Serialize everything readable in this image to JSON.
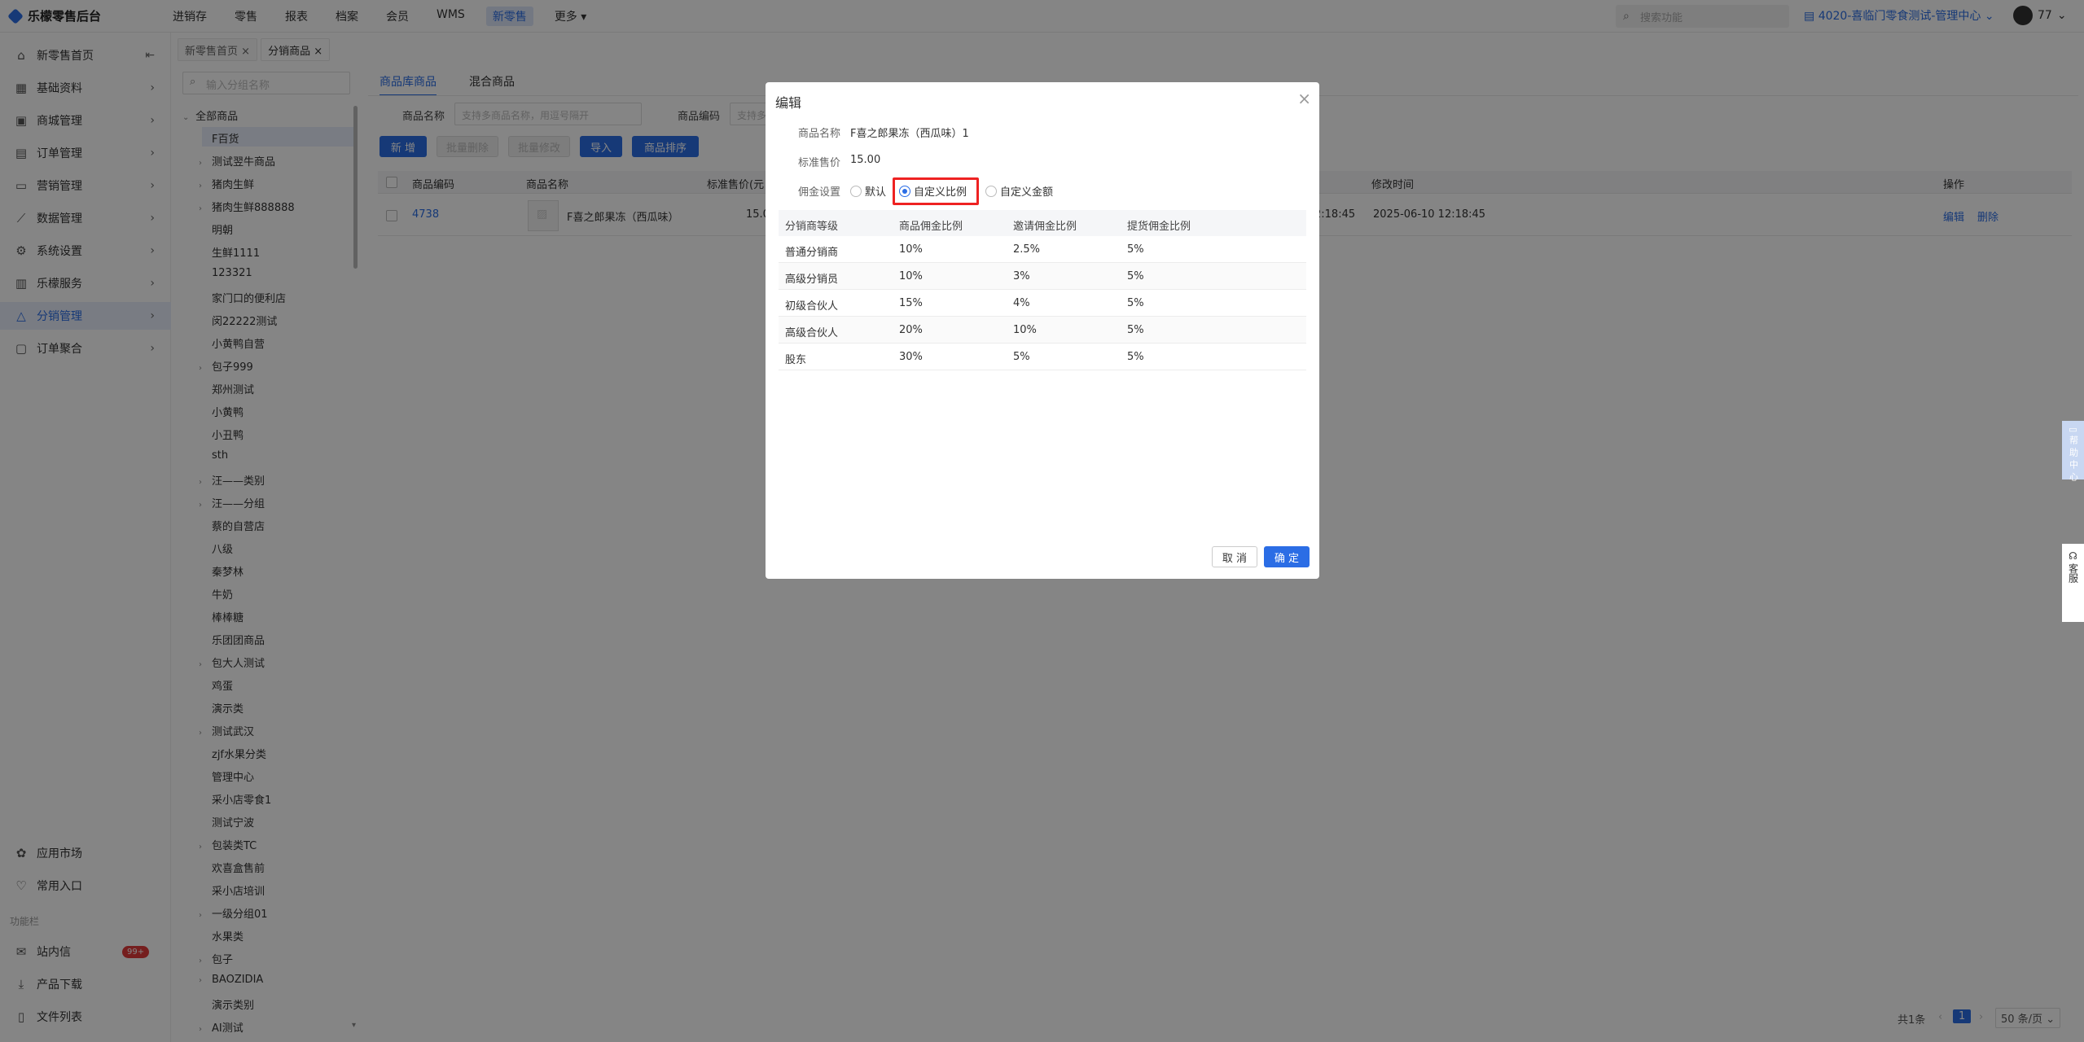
{
  "app": {
    "title": "乐檬零售后台"
  },
  "topnav": [
    "进销存",
    "零售",
    "报表",
    "档案",
    "会员",
    "WMS",
    "新零售",
    "更多"
  ],
  "topnav_active": 6,
  "search": {
    "placeholder": "搜索功能"
  },
  "store": "4020-喜临门零食测试-管理中心",
  "user": {
    "name": "77"
  },
  "sidebar": [
    {
      "label": "新零售首页",
      "icon": "home-icon"
    },
    {
      "label": "基础资料",
      "icon": "grid-icon"
    },
    {
      "label": "商城管理",
      "icon": "store-icon"
    },
    {
      "label": "订单管理",
      "icon": "order-icon"
    },
    {
      "label": "营销管理",
      "icon": "marketing-icon"
    },
    {
      "label": "数据管理",
      "icon": "chart-icon"
    },
    {
      "label": "系统设置",
      "icon": "gear-icon"
    },
    {
      "label": "乐檬服务",
      "icon": "service-icon"
    },
    {
      "label": "分销管理",
      "icon": "distribution-icon"
    },
    {
      "label": "订单聚合",
      "icon": "aggregate-icon"
    }
  ],
  "sidebar_bottom": [
    {
      "label": "应用市场",
      "icon": "apps-icon"
    },
    {
      "label": "常用入口",
      "icon": "heart-icon"
    }
  ],
  "sidebar_section": "功能栏",
  "sidebar_funcs": [
    {
      "label": "站内信",
      "icon": "mail-icon",
      "badge": "99+"
    },
    {
      "label": "产品下载",
      "icon": "download-icon"
    },
    {
      "label": "文件列表",
      "icon": "file-icon"
    }
  ],
  "page_tabs": [
    "新零售首页",
    "分销商品"
  ],
  "tree": {
    "placeholder": "输入分组名称",
    "root": "全部商品",
    "nodes": [
      {
        "label": "F百货",
        "expandable": false
      },
      {
        "label": "测试翌牛商品",
        "expandable": true
      },
      {
        "label": "猪肉生鲜",
        "expandable": true
      },
      {
        "label": "猪肉生鲜888888",
        "expandable": true
      },
      {
        "label": "明朝",
        "expandable": false
      },
      {
        "label": "生鲜1111",
        "expandable": false
      },
      {
        "label": "123321",
        "expandable": false
      },
      {
        "label": "家门口的便利店",
        "expandable": false
      },
      {
        "label": "闵22222测试",
        "expandable": false
      },
      {
        "label": "小黄鸭自营",
        "expandable": false
      },
      {
        "label": "包子999",
        "expandable": true
      },
      {
        "label": "郑州测试",
        "expandable": false
      },
      {
        "label": "小黄鸭",
        "expandable": false
      },
      {
        "label": "小丑鸭",
        "expandable": false
      },
      {
        "label": "sth",
        "expandable": false
      },
      {
        "label": "汪——类别",
        "expandable": true
      },
      {
        "label": "汪——分组",
        "expandable": true
      },
      {
        "label": "蔡的自营店",
        "expandable": false
      },
      {
        "label": "八级",
        "expandable": false
      },
      {
        "label": "秦梦林",
        "expandable": false
      },
      {
        "label": "牛奶",
        "expandable": false
      },
      {
        "label": "棒棒糖",
        "expandable": false
      },
      {
        "label": "乐团团商品",
        "expandable": false
      },
      {
        "label": "包大人测试",
        "expandable": true
      },
      {
        "label": "鸡蛋",
        "expandable": false
      },
      {
        "label": "演示类",
        "expandable": false
      },
      {
        "label": "测试武汉",
        "expandable": true
      },
      {
        "label": "zjf水果分类",
        "expandable": false
      },
      {
        "label": "管理中心",
        "expandable": false
      },
      {
        "label": "采小店零食1",
        "expandable": false
      },
      {
        "label": "测试宁波",
        "expandable": false
      },
      {
        "label": "包装类TC",
        "expandable": true
      },
      {
        "label": "欢喜盒售前",
        "expandable": false
      },
      {
        "label": "采小店培训",
        "expandable": false
      },
      {
        "label": "一级分组01",
        "expandable": true
      },
      {
        "label": "水果类",
        "expandable": false
      },
      {
        "label": "包子",
        "expandable": true
      },
      {
        "label": "BAOZIDIA",
        "expandable": true
      },
      {
        "label": "演示类别",
        "expandable": false
      },
      {
        "label": "AI测试",
        "expandable": true
      }
    ]
  },
  "main": {
    "subtabs": [
      "商品库商品",
      "混合商品"
    ],
    "filter": {
      "name_label": "商品名称",
      "name_placeholder": "支持多商品名称，用逗号隔开",
      "code_label": "商品编码",
      "code_placeholder": "支持多"
    },
    "buttons": {
      "add": "新 增",
      "batch_delete": "批量删除",
      "batch_edit": "批量修改",
      "import": "导入",
      "sort": "商品排序"
    },
    "table": {
      "headers": [
        "商品编码",
        "商品名称",
        "标准售价(元",
        "修改时间",
        "操作"
      ],
      "row": {
        "code": "4738",
        "name": "F喜之郎果冻（西瓜味）",
        "price": "15.0",
        "created_tail": "2:18:45",
        "modified": "2025-06-10 12:18:45",
        "edit": "编辑",
        "delete": "删除"
      }
    },
    "pager": {
      "total": "共1条",
      "page": "1",
      "page_size": "50 条/页"
    }
  },
  "modal": {
    "title": "编辑",
    "product_label": "商品名称",
    "product_value": "F喜之郎果冻（西瓜味）1",
    "price_label": "标准售价",
    "price_value": "15.00",
    "commission_label": "佣金设置",
    "options": [
      "默认",
      "自定义比例",
      "自定义金额"
    ],
    "selected_option": 1,
    "table_headers": [
      "分销商等级",
      "商品佣金比例",
      "邀请佣金比例",
      "提货佣金比例"
    ],
    "rows": [
      [
        "普通分销商",
        "10%",
        "2.5%",
        "5%"
      ],
      [
        "高级分销员",
        "10%",
        "3%",
        "5%"
      ],
      [
        "初级合伙人",
        "15%",
        "4%",
        "5%"
      ],
      [
        "高级合伙人",
        "20%",
        "10%",
        "5%"
      ],
      [
        "股东",
        "30%",
        "5%",
        "5%"
      ]
    ],
    "cancel": "取 消",
    "confirm": "确 定"
  },
  "float": {
    "help": "帮助中心",
    "service": "客服"
  },
  "colors": {
    "primary": "#2b6de5",
    "highlight": "#e22222",
    "badge": "#e03b3b"
  }
}
